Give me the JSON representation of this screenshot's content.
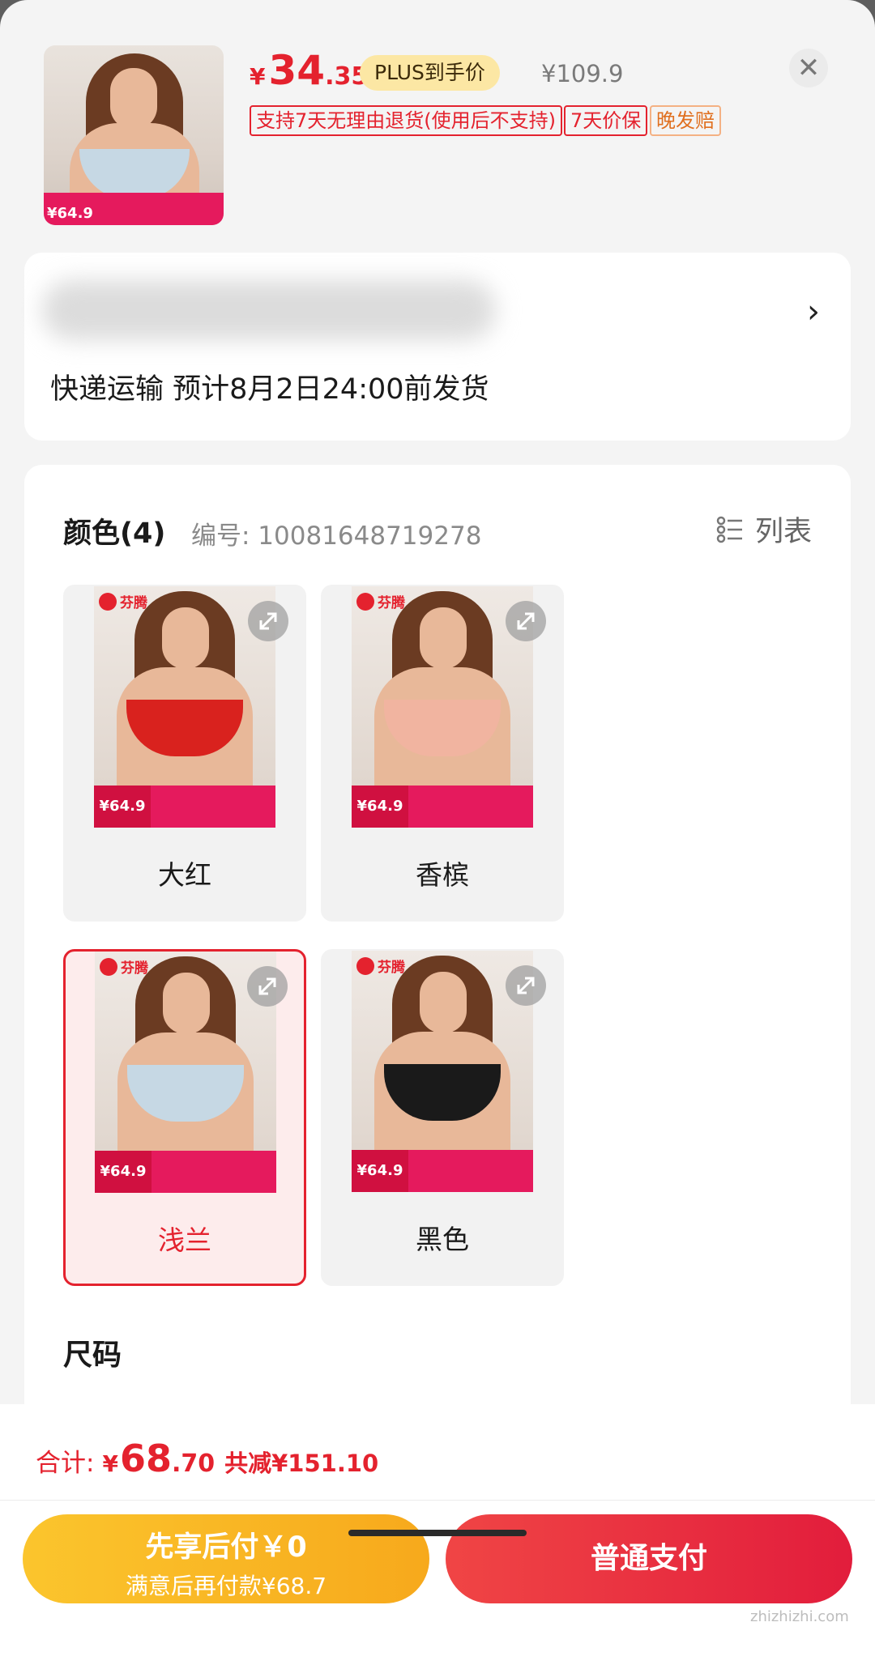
{
  "product": {
    "currency_symbol": "¥",
    "price_int": "34",
    "price_dec": ".35",
    "plus_label": "PLUS到手价",
    "original_price": "¥109.9",
    "thumb_promo_price": "¥64.9",
    "close_icon": "close-icon"
  },
  "service_tags": [
    "支持7天无理由退货(使用后不支持)",
    "7天价保",
    "晚发赔"
  ],
  "shipping": {
    "delivery_text": "快递运输 预计8月2日24:00前发货",
    "chevron": "›"
  },
  "spec": {
    "color_title": "颜色(4)",
    "sku_label": "编号: 10081648719278",
    "list_toggle_label": "列表",
    "colors": [
      {
        "name": "大红",
        "bra_color": "#d9221e",
        "selected": false
      },
      {
        "name": "香槟",
        "bra_color": "#f1b4a0",
        "selected": false
      },
      {
        "name": "浅兰",
        "bra_color": "#c6d8e4",
        "selected": true
      },
      {
        "name": "黑色",
        "bra_color": "#1a1a1a",
        "selected": false
      }
    ],
    "brand_logo_text": "芬腾",
    "swatch_promo_price": "¥64.9",
    "size_title": "尺码"
  },
  "footer": {
    "total_label": "合计:",
    "total_yen": "¥",
    "total_int": "68",
    "total_dec": ".70",
    "saved_label": "共减¥151.10",
    "pay_later_line1": "先享后付￥0",
    "pay_later_line2": "满意后再付款¥68.7",
    "pay_now_label": "普通支付"
  },
  "watermark": "zhizhizhi.com",
  "colors": {
    "accent_red": "#e4222e",
    "gold": "#f7a91c"
  }
}
